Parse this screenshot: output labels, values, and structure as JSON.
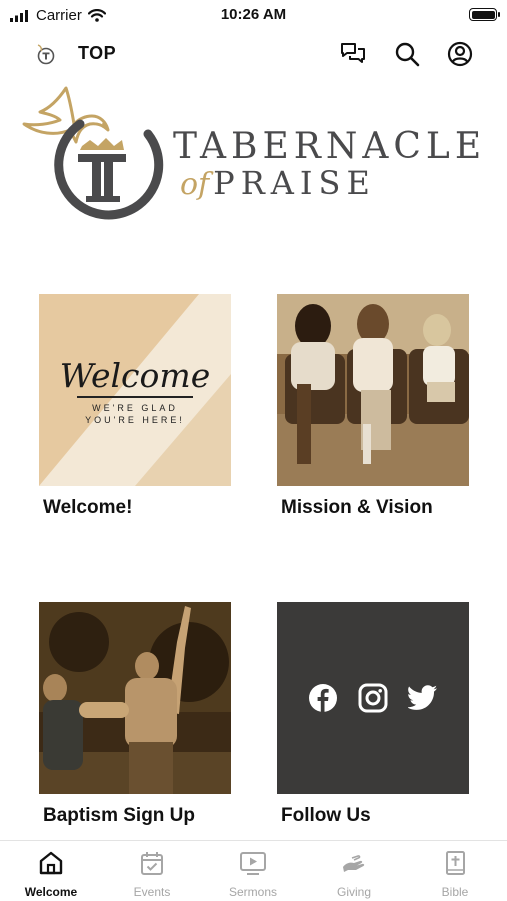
{
  "status_bar": {
    "carrier": "Carrier",
    "time": "10:26 AM"
  },
  "header": {
    "title": "TOP",
    "icons": [
      "chat-icon",
      "search-icon",
      "profile-icon"
    ]
  },
  "brand": {
    "line1": "TABERNACLE",
    "line2_italic": "of",
    "line2": "PRAISE",
    "mark_letter": "T",
    "colors": {
      "gold": "#c4a464",
      "charcoal": "#4a4a4c"
    }
  },
  "tiles": [
    {
      "label": "Welcome!",
      "art": {
        "script": "Welcome",
        "sub1": "WE'RE GLAD",
        "sub2": "YOU'RE HERE!"
      }
    },
    {
      "label": "Mission & Vision"
    },
    {
      "label": "Baptism Sign Up"
    },
    {
      "label": "Follow Us",
      "social_icons": [
        "facebook-icon",
        "instagram-icon",
        "twitter-icon"
      ]
    }
  ],
  "tabs": [
    {
      "label": "Welcome",
      "icon": "home-icon",
      "active": true
    },
    {
      "label": "Events",
      "icon": "calendar-icon",
      "active": false
    },
    {
      "label": "Sermons",
      "icon": "video-icon",
      "active": false
    },
    {
      "label": "Giving",
      "icon": "giving-hand-icon",
      "active": false
    },
    {
      "label": "Bible",
      "icon": "bible-icon",
      "active": false
    }
  ]
}
